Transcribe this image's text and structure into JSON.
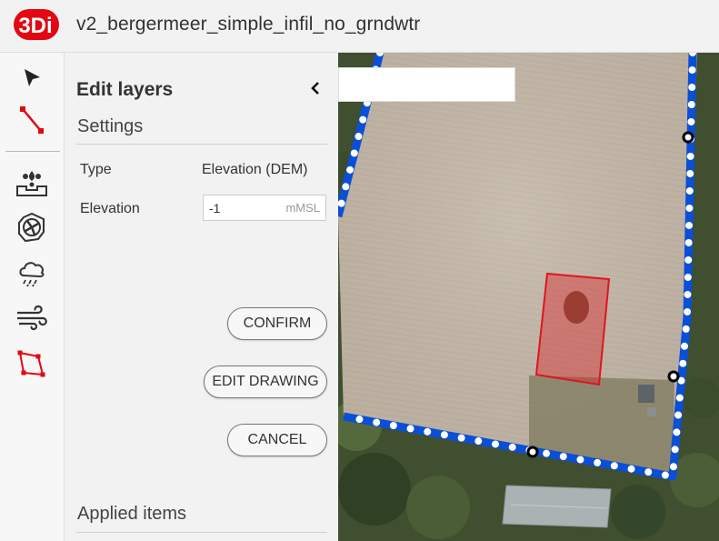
{
  "app": {
    "logo_text": "3Di",
    "title": "v2_bergermeer_simple_infil_no_grndwtr",
    "brand_color": "#e30613"
  },
  "toolbar": {
    "tools": [
      {
        "name": "select",
        "icon": "cursor-arrow-icon"
      },
      {
        "name": "draw-line",
        "icon": "line-draw-icon"
      },
      {
        "name": "infiltration",
        "icon": "infiltration-icon"
      },
      {
        "name": "pump",
        "icon": "pump-icon"
      },
      {
        "name": "rain",
        "icon": "rain-cloud-icon"
      },
      {
        "name": "wind",
        "icon": "wind-icon"
      },
      {
        "name": "polygon",
        "icon": "polygon-draw-icon"
      }
    ]
  },
  "panel": {
    "title": "Edit layers",
    "settings_heading": "Settings",
    "type_label": "Type",
    "type_value": "Elevation (DEM)",
    "elevation_label": "Elevation",
    "elevation_value": "-1",
    "elevation_unit": "mMSL",
    "confirm_label": "CONFIRM",
    "edit_drawing_label": "EDIT DRAWING",
    "cancel_label": "CANCEL",
    "applied_heading": "Applied items"
  },
  "map": {
    "search_value": "",
    "boundary_color": "#0a4fd6",
    "selection_color": "#e0141e"
  }
}
